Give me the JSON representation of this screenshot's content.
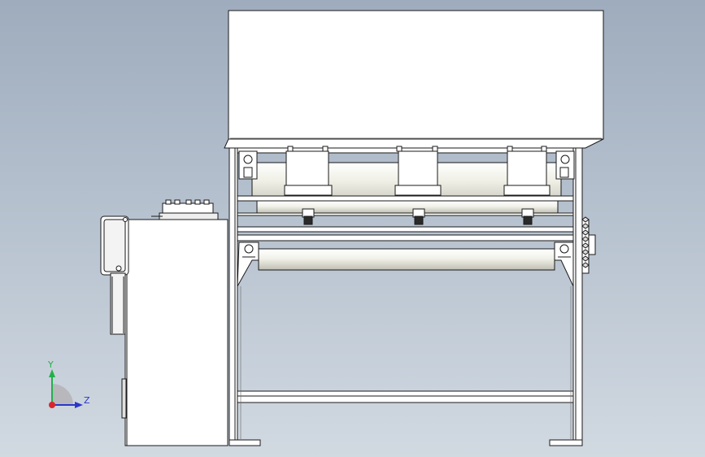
{
  "viewport": {
    "background_top": "#9eacbd",
    "background_bottom": "#d1d9e1",
    "model_line_color": "#1a1a1a",
    "model_fill": "#ffffff",
    "roller_shade": "#d9d9cf"
  },
  "triad": {
    "y_label": "Y",
    "z_label": "Z",
    "y_color": "#22b04a",
    "z_color": "#2a37c8",
    "x_color": "#d8262c"
  }
}
